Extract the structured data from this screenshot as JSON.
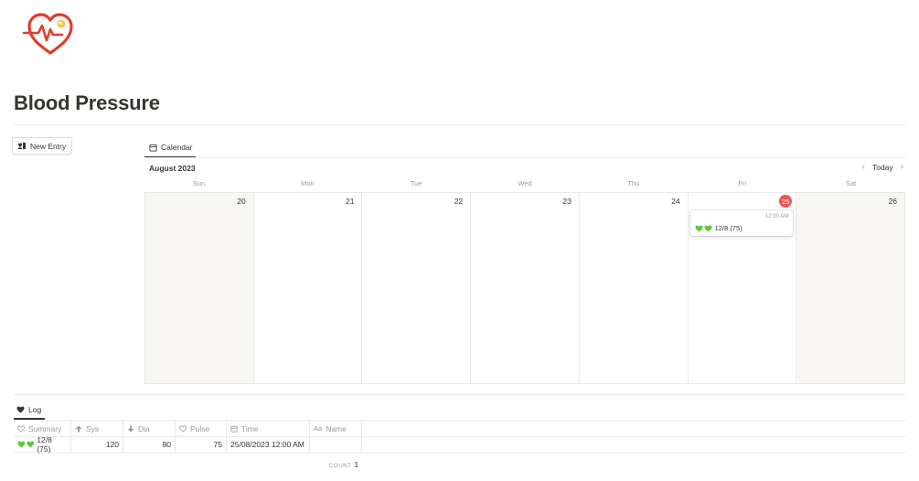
{
  "page": {
    "title": "Blood Pressure",
    "logo_icon": "heart-pulse-icon",
    "accent": "#e03e2d"
  },
  "actions": {
    "new_entry_label": "New Entry"
  },
  "calendar": {
    "tab_label": "Calendar",
    "month": "August 2023",
    "today_label": "Today",
    "weekdays": [
      "Sun",
      "Mon",
      "Tue",
      "Wed",
      "Thu",
      "Fri",
      "Sat"
    ],
    "days": [
      "20",
      "21",
      "22",
      "23",
      "24",
      "25",
      "26"
    ],
    "today_day": "25",
    "today_color": "#eb5757",
    "event": {
      "time": "12:00 AM",
      "title": "12/8 (75)",
      "emoji": "green-hearts"
    }
  },
  "log": {
    "tab_label": "Log",
    "columns": [
      {
        "label": "Summary",
        "icon": "heart-icon"
      },
      {
        "label": "Sys",
        "icon": "arrow-up-icon"
      },
      {
        "label": "Dia",
        "icon": "arrow-down-icon"
      },
      {
        "label": "Pulse",
        "icon": "heart-icon"
      },
      {
        "label": "Time",
        "icon": "calendar-icon"
      },
      {
        "label": "Name",
        "icon": "text-icon"
      }
    ],
    "rows": [
      {
        "summary": "12/8 (75)",
        "sys": "120",
        "dia": "80",
        "pulse": "75",
        "time": "25/08/2023 12:00 AM",
        "name": ""
      }
    ],
    "count_label": "COUNT",
    "count_value": "1"
  }
}
